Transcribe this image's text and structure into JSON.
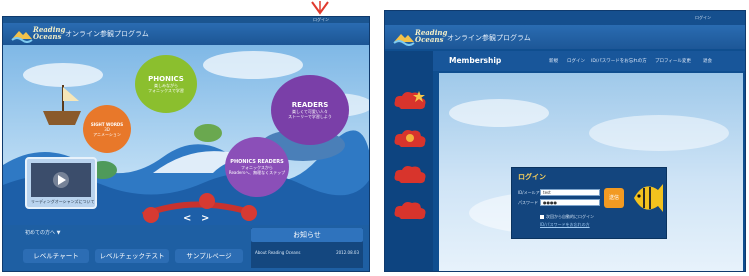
{
  "left": {
    "mini_nav": "ログイン",
    "app_title": "オンライン参観プログラム",
    "logo": {
      "line1": "Reading",
      "line2": "Oceans"
    },
    "bubbles": {
      "phonics": {
        "title": "PHONICS",
        "sub1": "楽しみながら",
        "sub2": "フォニックスで学習"
      },
      "readers": {
        "title": "READERS",
        "sub1": "楽しくて可愛い人々",
        "sub2": "ストーリーで学習しよう"
      },
      "sight_words": {
        "title": "SIGHT WORDS",
        "sub1": "3D",
        "sub2": "アニメーション"
      },
      "phonics_readers": {
        "title": "PHONICS READERS",
        "sub1": "フォニックスから",
        "sub2": "Readersへ、無理なくステップ"
      }
    },
    "video_caption": "リーディングオーシャンズについて",
    "first_visit": "初めての方へ ▼",
    "news_title": "お知らせ",
    "news_item": "About Reading Oceans",
    "news_date": "2012.08.03",
    "buttons": {
      "level_chart": "レベルチャート",
      "level_check": "レベルチェックテスト",
      "sample": "サンプルページ"
    },
    "nav": {
      "prev": "<",
      "next": ">"
    }
  },
  "right": {
    "mini_nav": "ログイン",
    "app_title": "オンライン参観プログラム",
    "logo": {
      "line1": "Reading",
      "line2": "Oceans"
    },
    "membership": "Membership",
    "menu": [
      "新規",
      "ログイン",
      "ID/パスワードをお忘れの方",
      "プロフィール変更",
      "退会"
    ],
    "login": {
      "title": "ログイン",
      "id_label": "ID/メールアドレス",
      "pw_label": "パスワード",
      "id_value": "test",
      "pw_value": "●●●●",
      "submit": "送信",
      "remember": "次回から自動的にログイン",
      "forgot": "ID/パスワードをお忘れの方"
    }
  },
  "colors": {
    "header_blue": "#2a6cb2",
    "accent_orange": "#f29a22",
    "arrow_red": "#e03a2e"
  }
}
